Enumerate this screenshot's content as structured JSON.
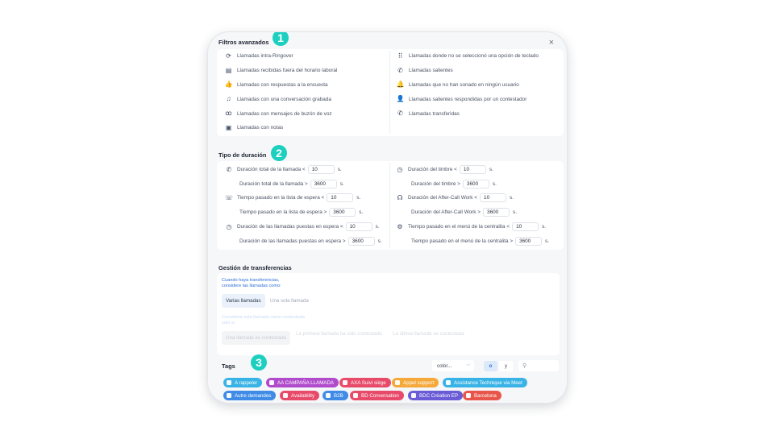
{
  "window": {
    "close_label": "×"
  },
  "steps": [
    "1",
    "2",
    "3"
  ],
  "advanced_filters": {
    "title": "Filtros avanzados",
    "left": [
      {
        "label": "Llamadas intra-Ringover",
        "icon": "loop-arrows-icon"
      },
      {
        "label": "Llamadas recibidas fuera del horario laboral",
        "icon": "calendar-icon"
      },
      {
        "label": "Llamadas con respuestas a la encuesta",
        "icon": "thumbs-up-icon"
      },
      {
        "label": "Llamadas con una conversación grabada",
        "icon": "music-note-icon"
      },
      {
        "label": "Llamadas con mensajes de buzón de voz",
        "icon": "voicemail-icon"
      },
      {
        "label": "Llamadas con notas",
        "icon": "note-icon"
      }
    ],
    "right": [
      {
        "label": "Llamadas donde no se seleccionó una opción de teclado",
        "icon": "keypad-icon"
      },
      {
        "label": "Llamadas salientes",
        "icon": "outgoing-call-icon"
      },
      {
        "label": "Llamadas que no han sonado en ningún usuario",
        "icon": "bell-icon"
      },
      {
        "label": "Llamadas salientes respondidas por un contestador",
        "icon": "user-icon"
      },
      {
        "label": "Llamadas transferidas",
        "icon": "transfer-call-icon"
      }
    ]
  },
  "duration": {
    "title": "Tipo de duración",
    "unit": "s.",
    "left": [
      {
        "label": "Duración total de la llamada <",
        "value": "10",
        "icon": "phone-clock-icon"
      },
      {
        "label": "Duración total de la llamada >",
        "value": "3600"
      },
      {
        "label": "Tiempo pasado en la lista de espera <",
        "value": "10",
        "icon": "queue-icon"
      },
      {
        "label": "Tiempo pasado en la lista de espera >",
        "value": "3600"
      },
      {
        "label": "Duración de las llamadas puestas en espera <",
        "value": "10",
        "icon": "hold-icon"
      },
      {
        "label": "Duración de las llamadas puestas en espera >",
        "value": "3600"
      }
    ],
    "right": [
      {
        "label": "Duración del timbre <",
        "value": "10",
        "icon": "ring-clock-icon"
      },
      {
        "label": "Duración del timbre >",
        "value": "3600"
      },
      {
        "label": "Duración del After-Call Work <",
        "value": "10",
        "icon": "headset-icon"
      },
      {
        "label": "Duración del After-Call Work >",
        "value": "3600"
      },
      {
        "label": "Tiempo pasado en el menú de la centralita <",
        "value": "10",
        "icon": "ivr-icon"
      },
      {
        "label": "Tiempo pasado en el menú de la centralita >",
        "value": "3600"
      }
    ]
  },
  "transfers": {
    "title": "Gestión de transferencias",
    "description_1": "Cuando haya transferencias,",
    "description_2": "considere las llamadas como:",
    "option_active": "Varias llamadas",
    "option_inactive": "Una sola llamada",
    "faded_desc_1": "Considera esta llamada como contestada",
    "faded_desc_2": "solo si",
    "faded_opt_1": "Una llamada es contestada",
    "faded_opt_2": "La primera llamada ha sido contestada",
    "faded_opt_3": "La última llamada se contestada"
  },
  "tags": {
    "title": "Tags",
    "color_select": "color...",
    "op_or": "o",
    "op_and": "y",
    "items": [
      {
        "label": "A rappeler",
        "color": "#39b3e6"
      },
      {
        "label": "AA CAMPAÑA LLAMADA",
        "color": "#b04ccc"
      },
      {
        "label": "AXA Suivi siège",
        "color": "#e84b6a"
      },
      {
        "label": "Appel support",
        "color": "#f4a93a"
      },
      {
        "label": "Assistance Technique via Meet",
        "color": "#39b3e6"
      },
      {
        "label": "Autre demandes",
        "color": "#3f8be6"
      },
      {
        "label": "Availability",
        "color": "#e84b6a"
      },
      {
        "label": "B2B",
        "color": "#3f8be6"
      },
      {
        "label": "BD Conversation",
        "color": "#e84b6a"
      },
      {
        "label": "BDC Création EP",
        "color": "#6a5cd6"
      },
      {
        "label": "Barcelona",
        "color": "#e8564b"
      }
    ]
  }
}
